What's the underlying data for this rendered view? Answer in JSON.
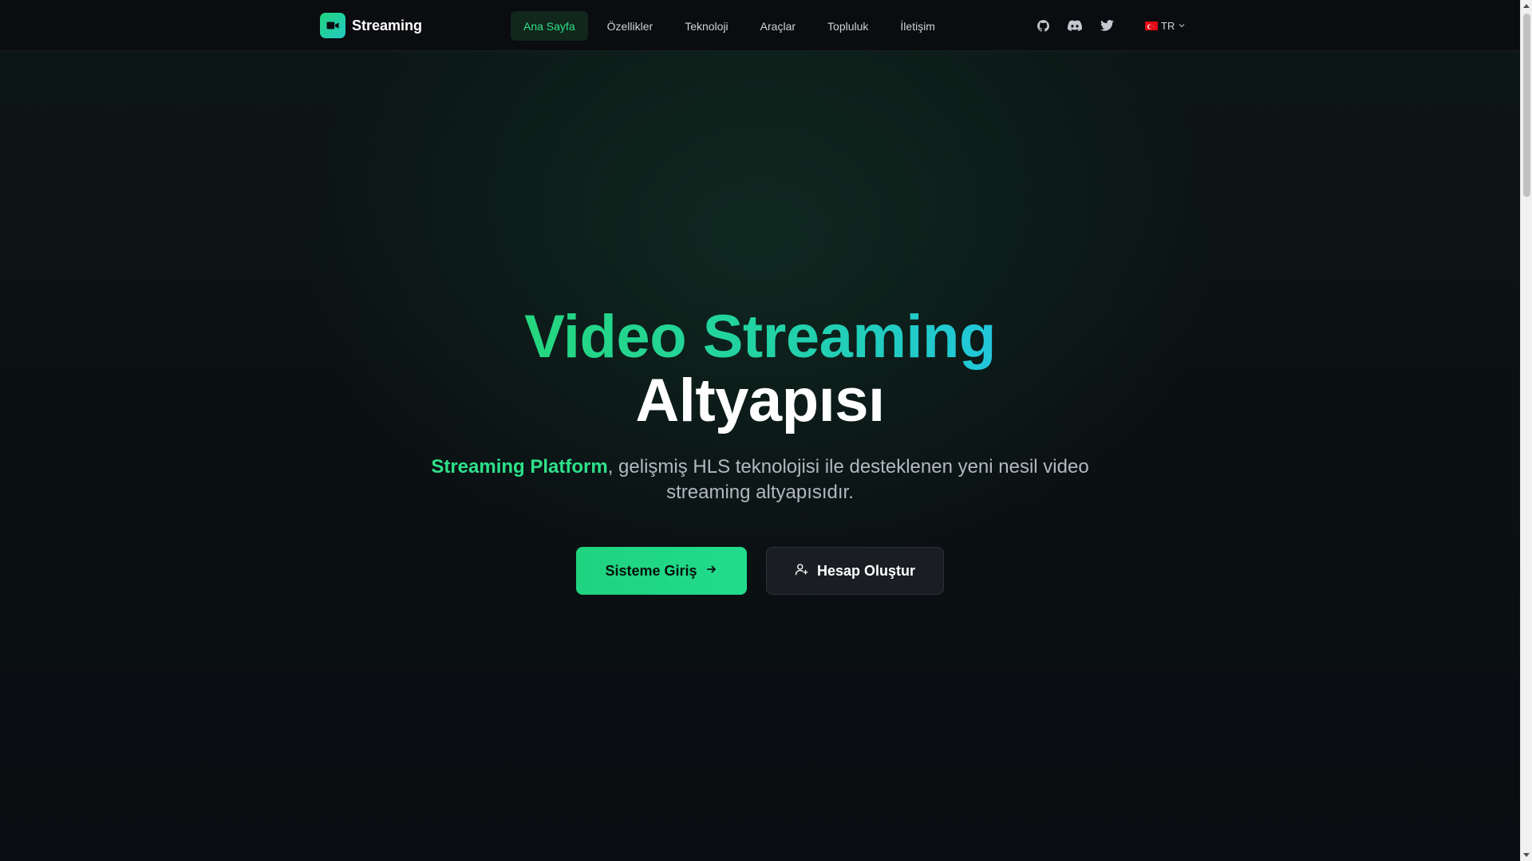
{
  "brand": {
    "name": "Streaming",
    "logo_icon": "video-camera-icon"
  },
  "nav": {
    "items": [
      {
        "label": "Ana Sayfa",
        "active": true
      },
      {
        "label": "Özellikler",
        "active": false
      },
      {
        "label": "Teknoloji",
        "active": false
      },
      {
        "label": "Araçlar",
        "active": false
      },
      {
        "label": "Topluluk",
        "active": false
      },
      {
        "label": "İletişim",
        "active": false
      }
    ]
  },
  "social": {
    "icons": [
      "github-icon",
      "discord-icon",
      "twitter-icon"
    ]
  },
  "language": {
    "code": "TR",
    "flag_icon": "turkey-flag-icon"
  },
  "hero": {
    "title_line1": "Video Streaming",
    "title_line2": "Altyapısı",
    "subtitle_highlight": "Streaming Platform",
    "subtitle_rest": ", gelişmiş HLS teknolojisi ile desteklenen yeni nesil video streaming altyapısıdır."
  },
  "cta": {
    "primary_label": "Sisteme Giriş",
    "secondary_label": "Hesap Oluştur"
  },
  "colors": {
    "accent": "#2ee08a",
    "accent_cyan": "#22c6dc",
    "background": "#0b0f13",
    "secondary_button": "#1a1e23"
  }
}
